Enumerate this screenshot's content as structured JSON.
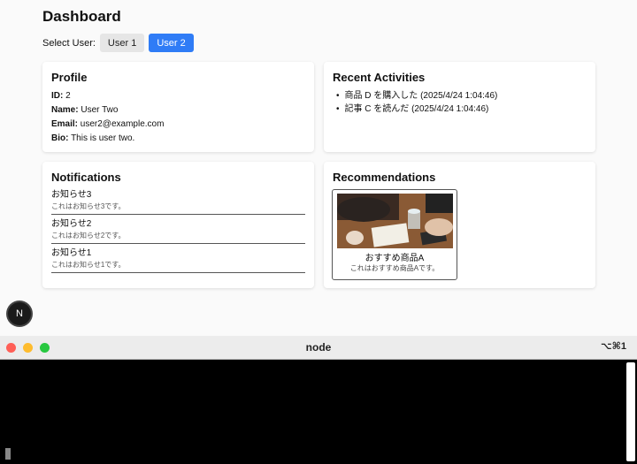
{
  "dashboard": {
    "title": "Dashboard",
    "select_label": "Select User:",
    "users": [
      "User 1",
      "User 2"
    ],
    "active_user": "User 2"
  },
  "profile": {
    "heading": "Profile",
    "id_label": "ID:",
    "id": "2",
    "name_label": "Name:",
    "name": "User Two",
    "email_label": "Email:",
    "email": "user2@example.com",
    "bio_label": "Bio:",
    "bio": "This is user two."
  },
  "activities": {
    "heading": "Recent Activities",
    "items": [
      "商品 D を購入した (2025/4/24 1:04:46)",
      "記事 C を読んだ (2025/4/24 1:04:46)"
    ]
  },
  "notifications": {
    "heading": "Notifications",
    "items": [
      {
        "title": "お知らせ3",
        "body": "これはお知らせ3です。"
      },
      {
        "title": "お知らせ2",
        "body": "これはお知らせ2です。"
      },
      {
        "title": "お知らせ1",
        "body": "これはお知らせ1です。"
      }
    ]
  },
  "recommendations": {
    "heading": "Recommendations",
    "item": {
      "title": "おすすめ商品A",
      "body": "これはおすすめ商品Aです。",
      "image": "photo-of-hands-writing-in-notebook"
    }
  },
  "next_badge": "N",
  "terminal": {
    "title": "node",
    "shortcut": "⌥⌘1"
  },
  "colors": {
    "primary": "#2f7cf6",
    "terminal_bg": "#000000"
  }
}
